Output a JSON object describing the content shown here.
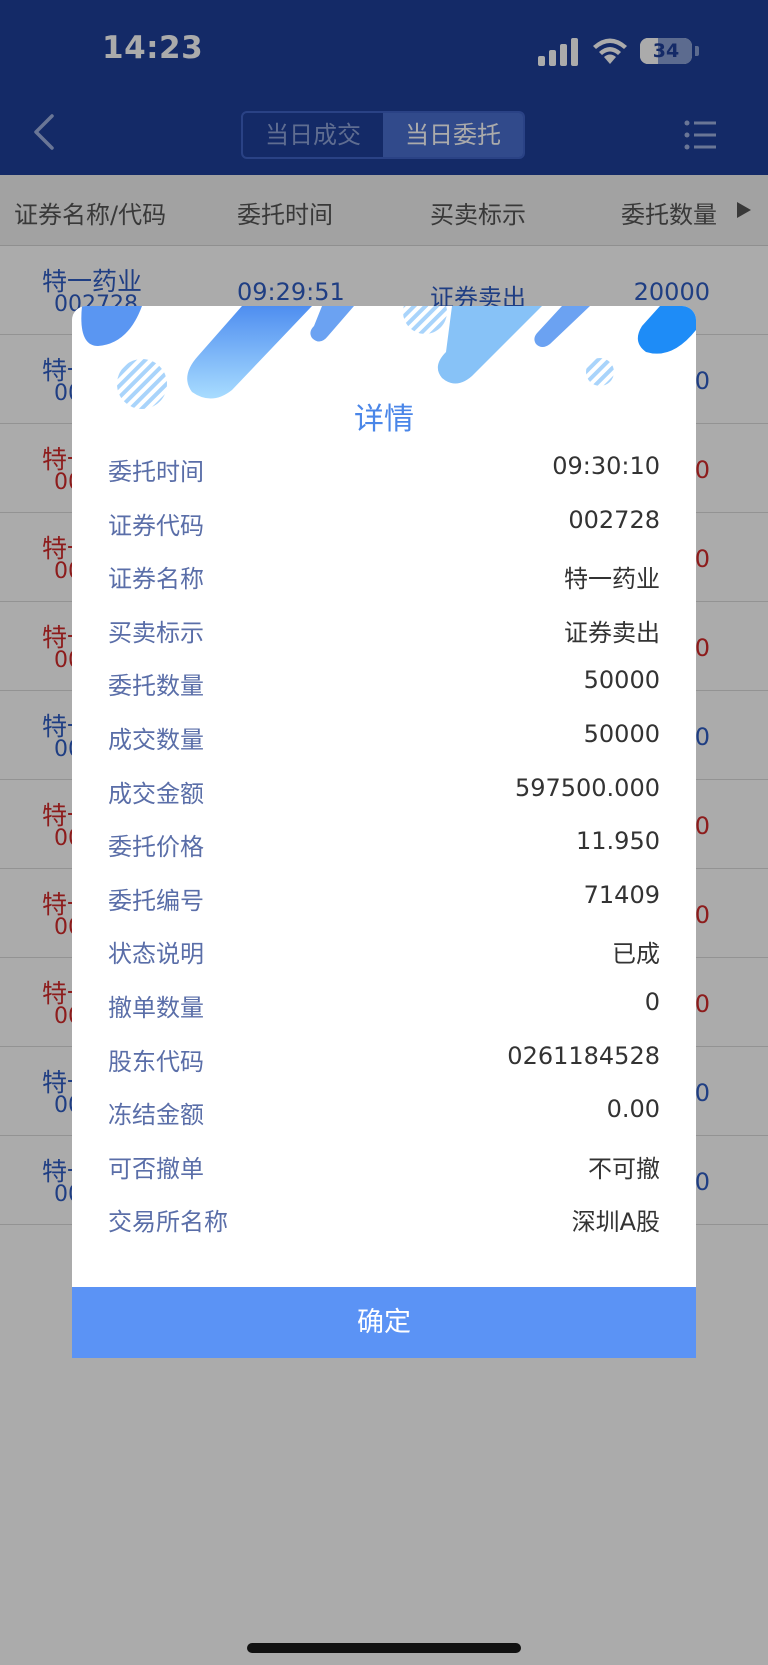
{
  "status_bar": {
    "time": "14:23",
    "battery": "34"
  },
  "nav": {
    "tabs": [
      {
        "label": "当日成交",
        "active": false
      },
      {
        "label": "当日委托",
        "active": true
      }
    ]
  },
  "columns": [
    "证券名称/代码",
    "委托时间",
    "买卖标示",
    "委托数量"
  ],
  "list_rows": [
    {
      "name": "特一药业",
      "code": "002728",
      "time": "09:29:51",
      "direction": "证券卖出",
      "quantity": "20000",
      "color": "blue"
    },
    {
      "name": "特一药业",
      "code": "002728",
      "time": "",
      "direction": "",
      "quantity": "0",
      "color": "blue"
    },
    {
      "name": "特一药业",
      "code": "002728",
      "time": "",
      "direction": "",
      "quantity": "0",
      "color": "red"
    },
    {
      "name": "特一药业",
      "code": "002728",
      "time": "",
      "direction": "",
      "quantity": "0",
      "color": "red"
    },
    {
      "name": "特一药业",
      "code": "002728",
      "time": "",
      "direction": "",
      "quantity": "0",
      "color": "red"
    },
    {
      "name": "特一药业",
      "code": "002728",
      "time": "",
      "direction": "",
      "quantity": "0",
      "color": "blue"
    },
    {
      "name": "特一药业",
      "code": "002728",
      "time": "",
      "direction": "",
      "quantity": "0",
      "color": "red"
    },
    {
      "name": "特一药业",
      "code": "002728",
      "time": "",
      "direction": "",
      "quantity": "0",
      "color": "red"
    },
    {
      "name": "特一药业",
      "code": "002728",
      "time": "",
      "direction": "",
      "quantity": "0",
      "color": "red"
    },
    {
      "name": "特一药业",
      "code": "002728",
      "time": "",
      "direction": "",
      "quantity": "0",
      "color": "blue"
    },
    {
      "name": "特一药业",
      "code": "002728",
      "time": "",
      "direction": "",
      "quantity": "0",
      "color": "blue"
    }
  ],
  "dialog": {
    "title": "详情",
    "fields": [
      {
        "label": "委托时间",
        "value": "09:30:10"
      },
      {
        "label": "证券代码",
        "value": "002728"
      },
      {
        "label": "证券名称",
        "value": "特一药业"
      },
      {
        "label": "买卖标示",
        "value": "证券卖出"
      },
      {
        "label": "委托数量",
        "value": "50000"
      },
      {
        "label": "成交数量",
        "value": "50000"
      },
      {
        "label": "成交金额",
        "value": "597500.000"
      },
      {
        "label": "委托价格",
        "value": "11.950"
      },
      {
        "label": "委托编号",
        "value": "71409"
      },
      {
        "label": "状态说明",
        "value": "已成"
      },
      {
        "label": "撤单数量",
        "value": "0"
      },
      {
        "label": "股东代码",
        "value": "0261184528"
      },
      {
        "label": "冻结金额",
        "value": "0.00"
      },
      {
        "label": "可否撤单",
        "value": "不可撤"
      },
      {
        "label": "交易所名称",
        "value": "深圳A股"
      }
    ],
    "confirm_label": "确定"
  },
  "colors": {
    "header_bg": "#1f3f9a",
    "accent": "#5b93f5",
    "buy_red": "#d22b2b",
    "sell_blue": "#2f5dc4"
  },
  "icons": [
    "back-chevron-icon",
    "menu-list-icon",
    "signal-icon",
    "wifi-icon",
    "battery-icon",
    "column-scroll-arrow-icon"
  ]
}
